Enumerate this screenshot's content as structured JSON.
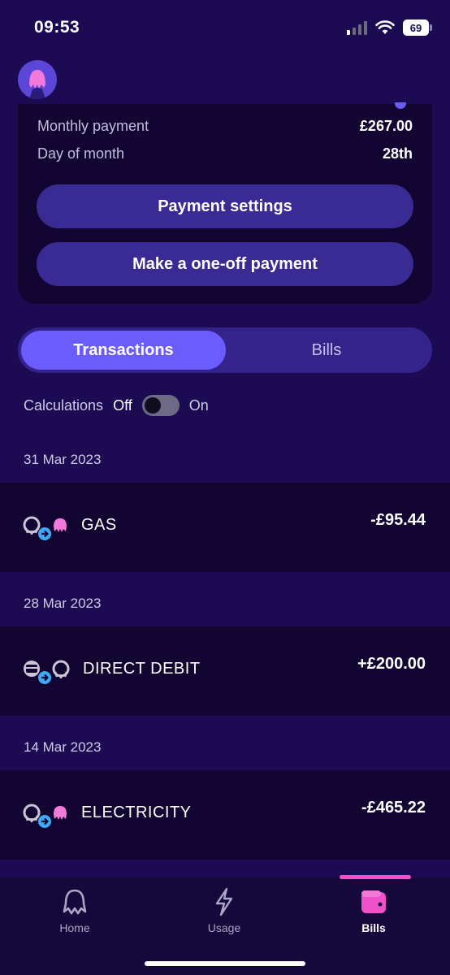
{
  "status_bar": {
    "time": "09:53",
    "battery": "69"
  },
  "payment_card": {
    "rows": [
      {
        "label": "Monthly payment",
        "value": "£267.00"
      },
      {
        "label": "Day of month",
        "value": "28th"
      }
    ],
    "payment_settings_label": "Payment settings",
    "one_off_label": "Make a one-off payment"
  },
  "segmented": {
    "transactions_label": "Transactions",
    "bills_label": "Bills",
    "active": "Transactions"
  },
  "calculations": {
    "label": "Calculations",
    "off_label": "Off",
    "on_label": "On",
    "enabled": false
  },
  "transactions": [
    {
      "date": "31 Mar 2023",
      "name": "GAS",
      "amount": "-£95.44",
      "icon": "octopus-to-pink-octopus"
    },
    {
      "date": "28 Mar 2023",
      "name": "DIRECT DEBIT",
      "amount": "+£200.00",
      "icon": "card-to-octopus"
    },
    {
      "date": "14 Mar 2023",
      "name": "ELECTRICITY",
      "amount": "-£465.22",
      "icon": "octopus-to-pink-octopus"
    }
  ],
  "tab_bar": {
    "home_label": "Home",
    "usage_label": "Usage",
    "bills_label": "Bills",
    "active": "Bills"
  },
  "colors": {
    "background": "#1c0b53",
    "card": "#120532",
    "button": "#3a2a93",
    "segment_active": "#6a5cff",
    "accent_pink": "#f050c8",
    "arrow_blue": "#3fa9f5"
  }
}
